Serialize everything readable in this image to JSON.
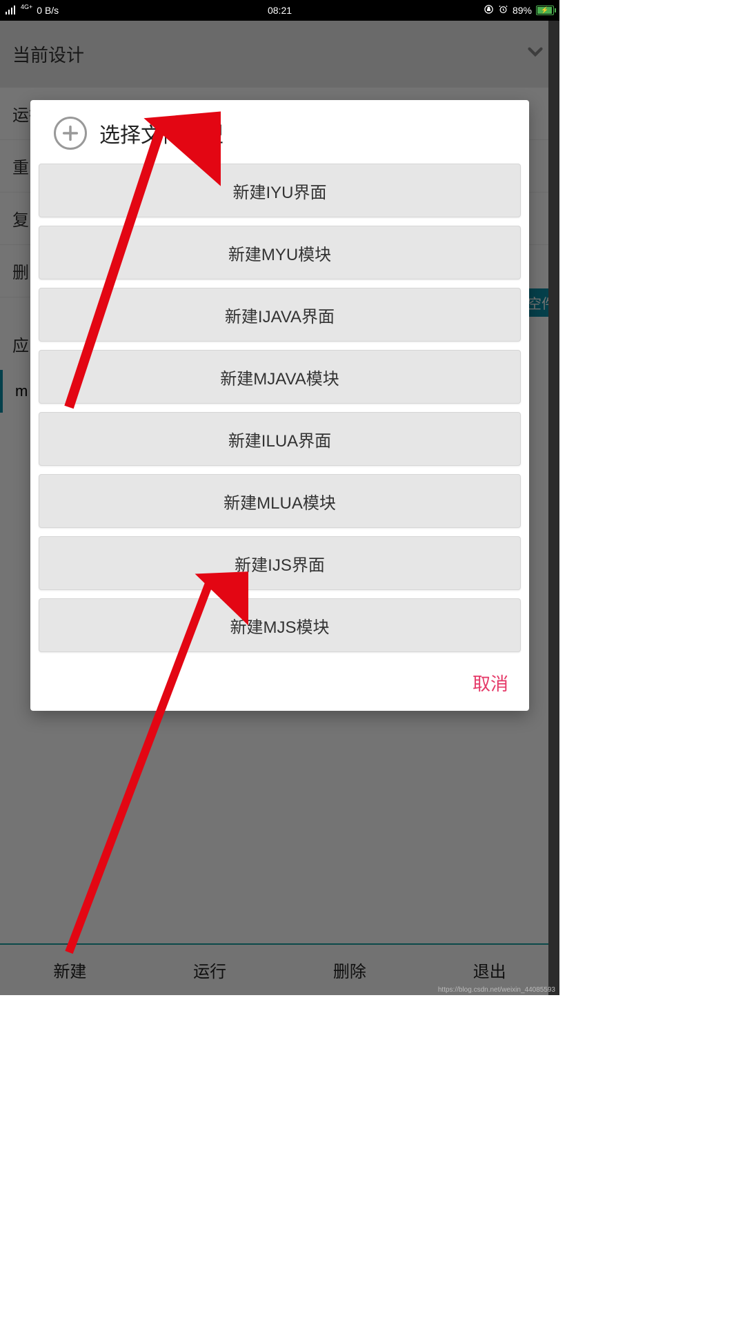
{
  "statusbar": {
    "network_type": "4G+",
    "data_rate": "0 B/s",
    "time": "08:21",
    "battery_pct": "89%"
  },
  "bg": {
    "header": "当前设计",
    "items": [
      "运行",
      "重",
      "复",
      "删"
    ],
    "section": "应",
    "file_prefix": "m",
    "pill": "空件",
    "tabs": [
      "新建",
      "运行",
      "删除",
      "退出"
    ]
  },
  "dialog": {
    "title": "选择文件类型",
    "options": [
      "新建IYU界面",
      "新建MYU模块",
      "新建IJAVA界面",
      "新建MJAVA模块",
      "新建ILUA界面",
      "新建MLUA模块",
      "新建IJS界面",
      "新建MJS模块"
    ],
    "cancel": "取消"
  },
  "watermark": "https://blog.csdn.net/weixin_44085593"
}
